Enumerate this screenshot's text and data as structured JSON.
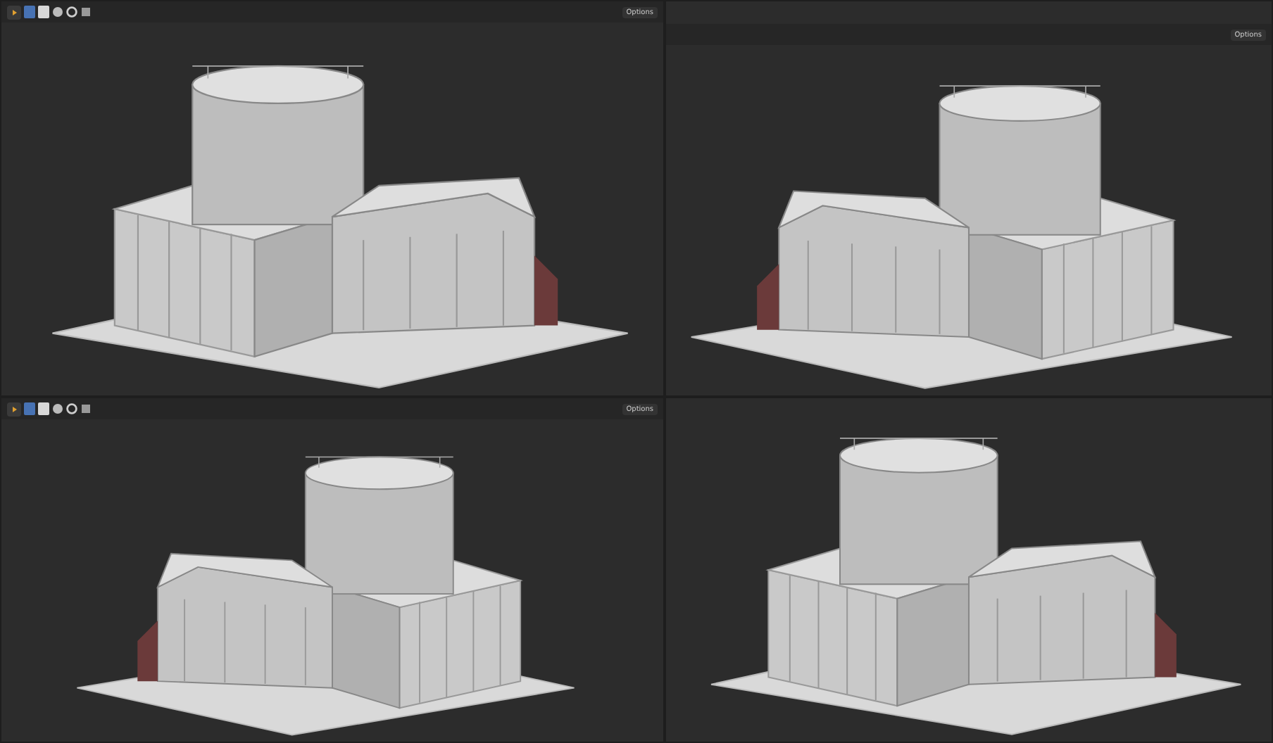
{
  "viewports": [
    {
      "kind": "full",
      "options": "Options",
      "mirrored": false
    },
    {
      "kind": "options_only",
      "options": "Options",
      "mirrored": true
    },
    {
      "kind": "full",
      "options": "Options",
      "mirrored": true
    },
    {
      "kind": "none",
      "mirrored": false
    }
  ]
}
